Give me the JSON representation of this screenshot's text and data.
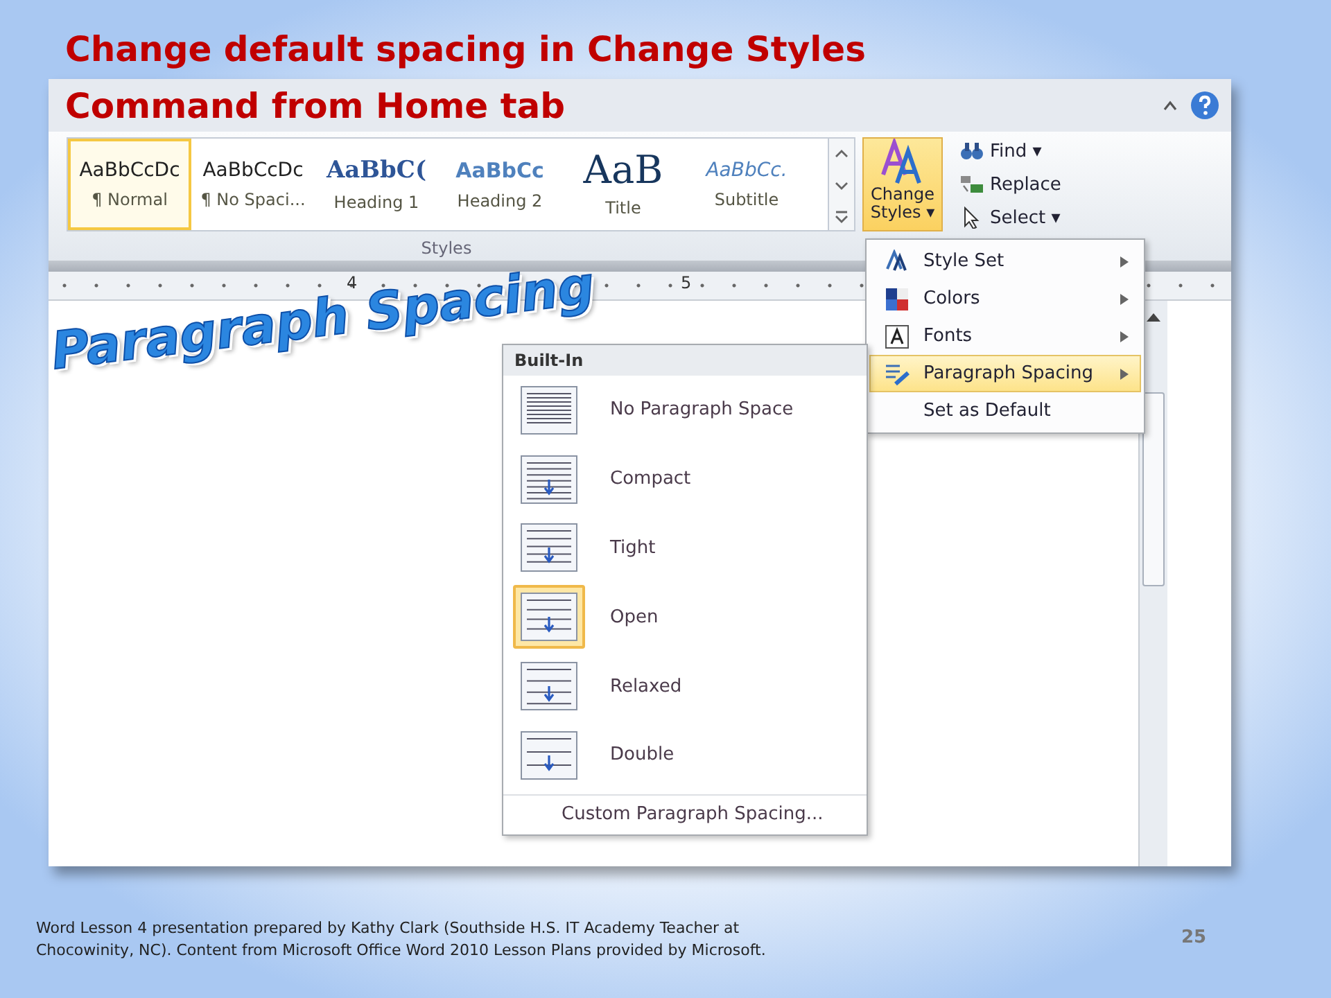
{
  "slide_title": [
    "Change default spacing in Change Styles",
    "Command from Home tab"
  ],
  "styles_gallery": [
    {
      "sample": "AaBbCcDc",
      "label": "¶ Normal",
      "kind": "normal",
      "selected": true
    },
    {
      "sample": "AaBbCcDc",
      "label": "¶ No Spaci...",
      "kind": "normal",
      "selected": false
    },
    {
      "sample": "AaBbC(",
      "label": "Heading 1",
      "kind": "heading1",
      "selected": false
    },
    {
      "sample": "AaBbCc",
      "label": "Heading 2",
      "kind": "heading2",
      "selected": false
    },
    {
      "sample": "AaB",
      "label": "Title",
      "kind": "title",
      "selected": false
    },
    {
      "sample": "AaBbCc.",
      "label": "Subtitle",
      "kind": "subtitle",
      "selected": false
    }
  ],
  "change_styles": {
    "label": "Change Styles ▾",
    "selected": true
  },
  "editing": [
    {
      "label": "Find ▾",
      "kind": "find"
    },
    {
      "label": "Replace",
      "kind": "replace"
    },
    {
      "label": "Select ▾",
      "kind": "select"
    }
  ],
  "group_label": "Styles",
  "ruler": [
    "4",
    "5"
  ],
  "wordart": "Paragraph Spacing",
  "change_styles_menu": [
    {
      "label": "Style Set",
      "kind": "styleset",
      "submenu": true,
      "selected": false
    },
    {
      "label": "Colors",
      "kind": "colors",
      "submenu": true,
      "selected": false
    },
    {
      "label": "Fonts",
      "kind": "fonts",
      "submenu": true,
      "selected": false
    },
    {
      "label": "Paragraph Spacing",
      "kind": "spacing",
      "submenu": true,
      "selected": true
    },
    {
      "label": "Set as Default",
      "kind": "none",
      "submenu": false,
      "selected": false
    }
  ],
  "spacing_menu": {
    "header": "Built-In",
    "options": [
      {
        "label": "No Paragraph Space",
        "selected": false
      },
      {
        "label": "Compact",
        "selected": false
      },
      {
        "label": "Tight",
        "selected": false
      },
      {
        "label": "Open",
        "selected": true
      },
      {
        "label": "Relaxed",
        "selected": false
      },
      {
        "label": "Double",
        "selected": false
      }
    ],
    "footer": "Custom Paragraph Spacing..."
  },
  "footer_note": "Word Lesson 4 presentation  prepared  by Kathy Clark (Southside  H.S. IT Academy Teacher at Chocowinity,  NC). Content  from Microsoft  Office Word 2010 Lesson Plans provided  by Microsoft.",
  "slide_number": "25"
}
